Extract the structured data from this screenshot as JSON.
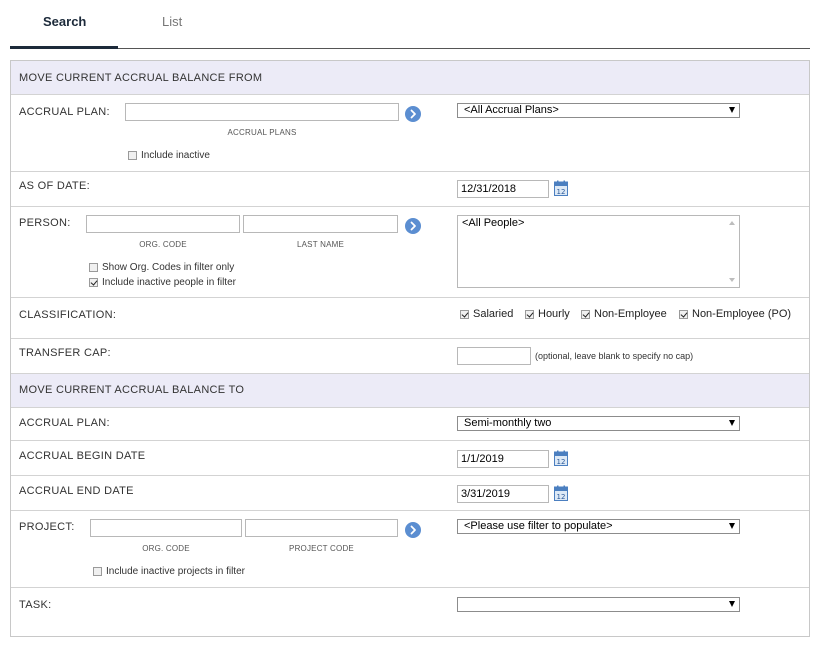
{
  "tabs": [
    {
      "label": "Search"
    },
    {
      "label": "List"
    }
  ],
  "from": {
    "header": "MOVE CURRENT ACCRUAL BALANCE FROM",
    "accrual_plan": {
      "label": "ACCRUAL PLAN:",
      "input_value": "",
      "sublabel": "ACCRUAL PLANS",
      "include_inactive": {
        "label": "Include inactive",
        "checked": false
      },
      "select": "<All Accrual Plans>"
    },
    "as_of_date": {
      "label": "AS OF DATE:",
      "value": "12/31/2018"
    },
    "person": {
      "label": "PERSON:",
      "org_code_value": "",
      "last_name_value": "",
      "org_code_label": "ORG. CODE",
      "last_name_label": "LAST NAME",
      "show_org_codes": {
        "label": "Show Org. Codes in filter only",
        "checked": false
      },
      "include_inactive": {
        "label": "Include inactive people in filter",
        "checked": true
      },
      "list_value": "<All People>"
    },
    "classification": {
      "label": "CLASSIFICATION:",
      "options": [
        {
          "label": "Salaried",
          "checked": true
        },
        {
          "label": "Hourly",
          "checked": true
        },
        {
          "label": "Non-Employee",
          "checked": true
        },
        {
          "label": "Non-Employee (PO)",
          "checked": true
        }
      ]
    },
    "transfer_cap": {
      "label": "TRANSFER CAP:",
      "value": "",
      "note": "(optional, leave blank to specify no cap)"
    }
  },
  "to": {
    "header": "MOVE CURRENT ACCRUAL BALANCE TO",
    "accrual_plan": {
      "label": "ACCRUAL PLAN:",
      "select": "Semi-monthly two"
    },
    "begin_date": {
      "label": "ACCRUAL BEGIN DATE",
      "value": "1/1/2019"
    },
    "end_date": {
      "label": "ACCRUAL END DATE",
      "value": "3/31/2019"
    },
    "project": {
      "label": "PROJECT:",
      "org_code_value": "",
      "project_code_value": "",
      "org_code_label": "ORG. CODE",
      "project_code_label": "PROJECT CODE",
      "include_inactive": {
        "label": "Include inactive projects in filter",
        "checked": false
      },
      "select": "<Please use filter to populate>"
    },
    "task": {
      "label": "TASK:",
      "select": ""
    }
  },
  "icons": {
    "go": "arrow-right-circle-icon",
    "calendar": "calendar-icon"
  },
  "colors": {
    "header_bg": "#ecebf7",
    "go_button": "#5b8ed1",
    "tab_active": "#1c2a3a"
  }
}
